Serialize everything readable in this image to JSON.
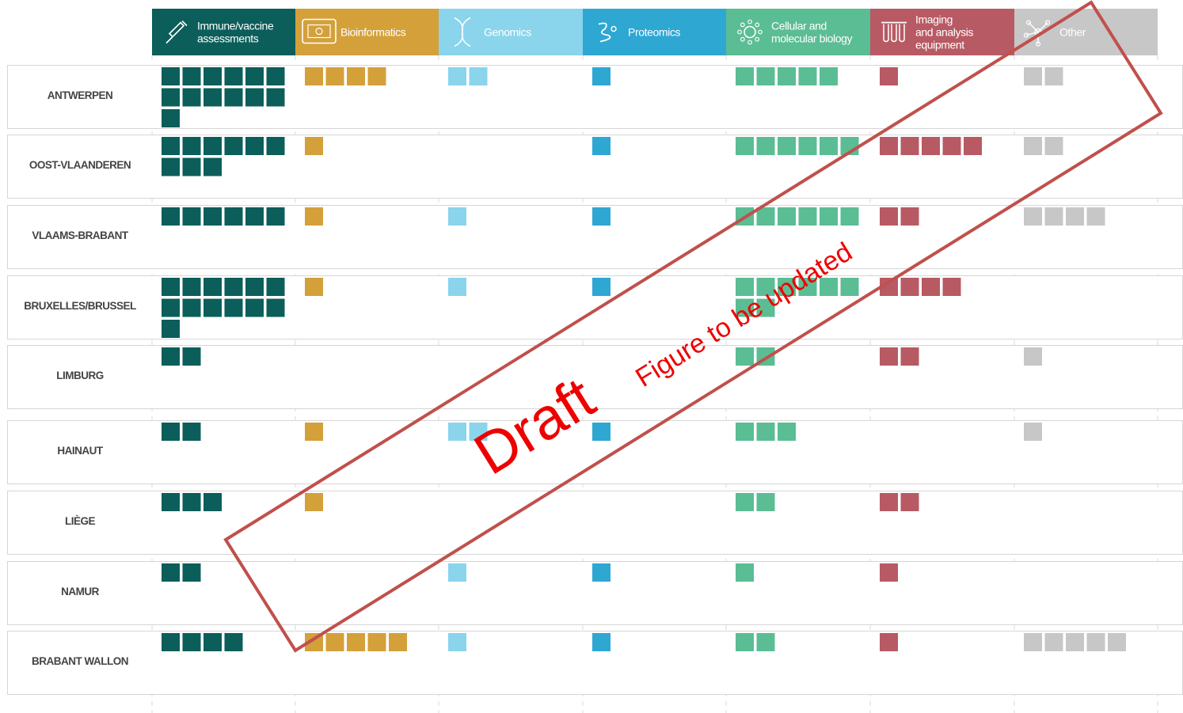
{
  "chart_data": {
    "type": "table",
    "columns": [
      {
        "label_lines": [
          "Immune/vaccine",
          "assessments"
        ],
        "color": "#0b5e5a",
        "icon": "syringe-icon"
      },
      {
        "label_lines": [
          "Bioinformatics"
        ],
        "color": "#d4a03a",
        "icon": "computer-network-icon"
      },
      {
        "label_lines": [
          "Genomics"
        ],
        "color": "#8ad4ec",
        "icon": "dna-icon"
      },
      {
        "label_lines": [
          "Proteomics"
        ],
        "color": "#2ea7d3",
        "icon": "protein-icon"
      },
      {
        "label_lines": [
          "Cellular and",
          "molecular biology"
        ],
        "color": "#5bbd94",
        "icon": "cell-icon"
      },
      {
        "label_lines": [
          "Imaging",
          "and analysis",
          "equipment"
        ],
        "color": "#b85a63",
        "icon": "test-tubes-icon"
      },
      {
        "label_lines": [
          "Other"
        ],
        "color": "#c7c7c7",
        "icon": "molecule-icon"
      }
    ],
    "rows": [
      {
        "label": "ANTWERPEN",
        "counts": [
          13,
          4,
          2,
          1,
          5,
          1,
          2
        ]
      },
      {
        "label": "OOST-VLAANDEREN",
        "counts": [
          9,
          1,
          0,
          1,
          6,
          5,
          2
        ]
      },
      {
        "label": "VLAAMS-BRABANT",
        "counts": [
          6,
          1,
          1,
          1,
          6,
          2,
          4
        ]
      },
      {
        "label": "BRUXELLES/BRUSSEL",
        "counts": [
          13,
          1,
          1,
          1,
          8,
          4,
          0
        ]
      },
      {
        "label": "LIMBURG",
        "counts": [
          2,
          0,
          0,
          0,
          2,
          2,
          1
        ]
      },
      {
        "label": "HAINAUT",
        "counts": [
          2,
          1,
          2,
          1,
          3,
          0,
          1
        ]
      },
      {
        "label": "LIÈGE",
        "counts": [
          3,
          1,
          0,
          0,
          2,
          2,
          0
        ]
      },
      {
        "label": "NAMUR",
        "counts": [
          2,
          0,
          1,
          1,
          1,
          1,
          0
        ]
      },
      {
        "label": "BRABANT WALLON",
        "counts": [
          4,
          5,
          1,
          1,
          2,
          1,
          5
        ]
      }
    ]
  },
  "watermark": {
    "main": "Draft",
    "sub": "Figure to be updated",
    "text_color": "#ee0000",
    "box_color": "#c0504d"
  }
}
